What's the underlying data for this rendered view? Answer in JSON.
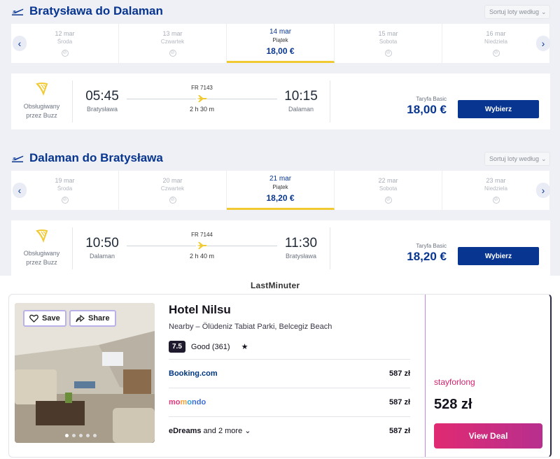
{
  "outbound": {
    "title": "Bratysława do Dalaman",
    "sort_label": "Sortuj loty według",
    "dates": [
      {
        "date": "12 mar",
        "weekday": "Środa",
        "price": ""
      },
      {
        "date": "13 mar",
        "weekday": "Czwartek",
        "price": ""
      },
      {
        "date": "14 mar",
        "weekday": "Piątek",
        "price": "18,00 €",
        "selected": true
      },
      {
        "date": "15 mar",
        "weekday": "Sobota",
        "price": ""
      },
      {
        "date": "16 mar",
        "weekday": "Niedziela",
        "price": ""
      }
    ],
    "flight": {
      "operator_line1": "Obsługiwany",
      "operator_line2": "przez Buzz",
      "dep_time": "05:45",
      "dep_city": "Bratysława",
      "flight_no": "FR 7143",
      "duration": "2 h 30 m",
      "arr_time": "10:15",
      "arr_city": "Dalaman",
      "fare_label": "Taryfa Basic",
      "price": "18,00 €",
      "button": "Wybierz"
    }
  },
  "inbound": {
    "title": "Dalaman do Bratysława",
    "sort_label": "Sortuj loty według",
    "dates": [
      {
        "date": "19 mar",
        "weekday": "Środa",
        "price": ""
      },
      {
        "date": "20 mar",
        "weekday": "Czwartek",
        "price": ""
      },
      {
        "date": "21 mar",
        "weekday": "Piątek",
        "price": "18,20 €",
        "selected": true
      },
      {
        "date": "22 mar",
        "weekday": "Sobota",
        "price": ""
      },
      {
        "date": "23 mar",
        "weekday": "Niedziela",
        "price": ""
      }
    ],
    "flight": {
      "operator_line1": "Obsługiwany",
      "operator_line2": "przez Buzz",
      "dep_time": "10:50",
      "dep_city": "Dalaman",
      "flight_no": "FR 7144",
      "duration": "2 h 40 m",
      "arr_time": "11:30",
      "arr_city": "Bratysława",
      "fare_label": "Taryfa Basic",
      "price": "18,20 €",
      "button": "Wybierz"
    }
  },
  "ad": {
    "brand": "LastMinuter",
    "save_label": "Save",
    "share_label": "Share",
    "hotel_name": "Hotel Nilsu",
    "nearby": "Nearby – Ölüdeniz Tabiat Parki, Belcegiz Beach",
    "score": "7.5",
    "rating_text": "Good (361)",
    "providers": [
      {
        "name": "Booking.com",
        "price": "587 zł"
      },
      {
        "name": "momondo",
        "price": "587 zł"
      },
      {
        "name": "eDreams",
        "more": "and 2 more",
        "price": "587 zł"
      }
    ],
    "deal_provider": "stayforlong",
    "deal_price": "528 zł",
    "deal_button": "View Deal"
  },
  "colors": {
    "brand_blue": "#073590",
    "yellow": "#f1c933",
    "deal_pink": "#d2226f"
  }
}
